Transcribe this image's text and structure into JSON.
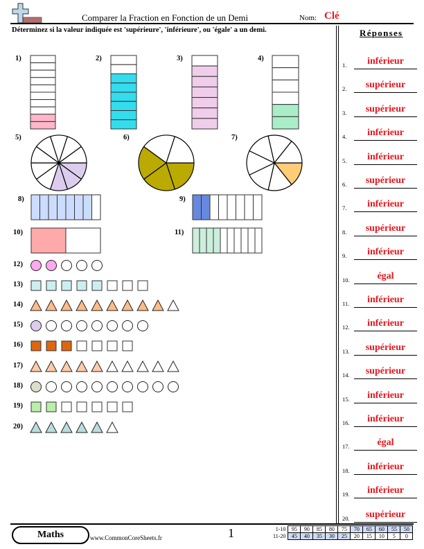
{
  "header": {
    "title": "Comparer la Fraction en Fonction de un Demi",
    "name_label": "Nom:",
    "name_value": "Clé",
    "instructions": "Déterminez si la valeur indiquée est 'supérieure', 'inférieure', ou 'égale' a un demi."
  },
  "answers": {
    "title": "Réponses",
    "items": [
      {
        "num": "1.",
        "text": "inférieur"
      },
      {
        "num": "2.",
        "text": "supérieur"
      },
      {
        "num": "3.",
        "text": "supérieur"
      },
      {
        "num": "4.",
        "text": "inférieur"
      },
      {
        "num": "5.",
        "text": "inférieur"
      },
      {
        "num": "6.",
        "text": "supérieur"
      },
      {
        "num": "7.",
        "text": "inférieur"
      },
      {
        "num": "8.",
        "text": "supérieur"
      },
      {
        "num": "9.",
        "text": "inférieur"
      },
      {
        "num": "10.",
        "text": "égal"
      },
      {
        "num": "11.",
        "text": "inférieur"
      },
      {
        "num": "12.",
        "text": "inférieur"
      },
      {
        "num": "13.",
        "text": "supérieur"
      },
      {
        "num": "14.",
        "text": "supérieur"
      },
      {
        "num": "15.",
        "text": "inférieur"
      },
      {
        "num": "16.",
        "text": "inférieur"
      },
      {
        "num": "17.",
        "text": "égal"
      },
      {
        "num": "18.",
        "text": "inférieur"
      },
      {
        "num": "19.",
        "text": "inférieur"
      },
      {
        "num": "20.",
        "text": "supérieur"
      }
    ]
  },
  "problems": [
    {
      "label": "1)",
      "type": "vbar",
      "parts": 10,
      "shaded": 2,
      "color": "#ffb6c8"
    },
    {
      "label": "2)",
      "type": "vbar",
      "parts": 8,
      "shaded": 6,
      "color": "#33ddee"
    },
    {
      "label": "3)",
      "type": "vbar",
      "parts": 7,
      "shaded": 6,
      "color": "#efcdeb"
    },
    {
      "label": "4)",
      "type": "vbar",
      "parts": 6,
      "shaded": 2,
      "color": "#aaeec8"
    },
    {
      "label": "5)",
      "type": "pie",
      "parts": 10,
      "shaded": 3,
      "color": "#dccdee"
    },
    {
      "label": "6)",
      "type": "pie",
      "parts": 5,
      "shaded": 3,
      "color": "#bbaa00"
    },
    {
      "label": "7)",
      "type": "pie",
      "parts": 7,
      "shaded": 1,
      "color": "#ffcc77"
    },
    {
      "label": "8)",
      "type": "hbar",
      "parts": 8,
      "shaded": 7,
      "color": "#ccdcff"
    },
    {
      "label": "9)",
      "type": "hbar",
      "parts": 8,
      "shaded": 2,
      "color": "#6688dd"
    },
    {
      "label": "10)",
      "type": "hbar",
      "parts": 2,
      "shaded": 1,
      "color": "#ffaaaa"
    },
    {
      "label": "11)",
      "type": "hbar",
      "parts": 10,
      "shaded": 4,
      "color": "#cceedd"
    },
    {
      "label": "12)",
      "type": "circles",
      "parts": 5,
      "shaded": 2,
      "color": "#ffaaee"
    },
    {
      "label": "13)",
      "type": "squares",
      "parts": 8,
      "shaded": 5,
      "color": "#cceeee"
    },
    {
      "label": "14)",
      "type": "triangles",
      "parts": 10,
      "shaded": 9,
      "color": "#ffbb88"
    },
    {
      "label": "15)",
      "type": "circles",
      "parts": 8,
      "shaded": 1,
      "color": "#ddccee"
    },
    {
      "label": "16)",
      "type": "squares",
      "parts": 7,
      "shaded": 3,
      "color": "#dd6611"
    },
    {
      "label": "17)",
      "type": "triangles",
      "parts": 10,
      "shaded": 5,
      "color": "#ffccaa"
    },
    {
      "label": "18)",
      "type": "circles",
      "parts": 10,
      "shaded": 1,
      "color": "#ddddcc"
    },
    {
      "label": "19)",
      "type": "squares",
      "parts": 7,
      "shaded": 2,
      "color": "#bbeeaa"
    },
    {
      "label": "20)",
      "type": "triangles",
      "parts": 6,
      "shaded": 5,
      "color": "#bbdddd"
    }
  ],
  "footer": {
    "subject": "Maths",
    "site": "www.CommonCoreSheets.fr",
    "page": "1",
    "score_rows": [
      {
        "label": "1-10",
        "values": [
          "95",
          "90",
          "85",
          "80",
          "75",
          "70",
          "65",
          "60",
          "55",
          "50"
        ],
        "highlight": [
          false,
          false,
          false,
          false,
          false,
          true,
          true,
          true,
          true,
          true
        ]
      },
      {
        "label": "11-20",
        "values": [
          "45",
          "40",
          "35",
          "30",
          "25",
          "20",
          "15",
          "10",
          "5",
          "0"
        ],
        "highlight": [
          true,
          true,
          true,
          true,
          true,
          false,
          false,
          false,
          false,
          false
        ]
      }
    ]
  },
  "colors": {
    "answer_red": "#e8141c",
    "score_highlight": "#cfdcf6"
  }
}
